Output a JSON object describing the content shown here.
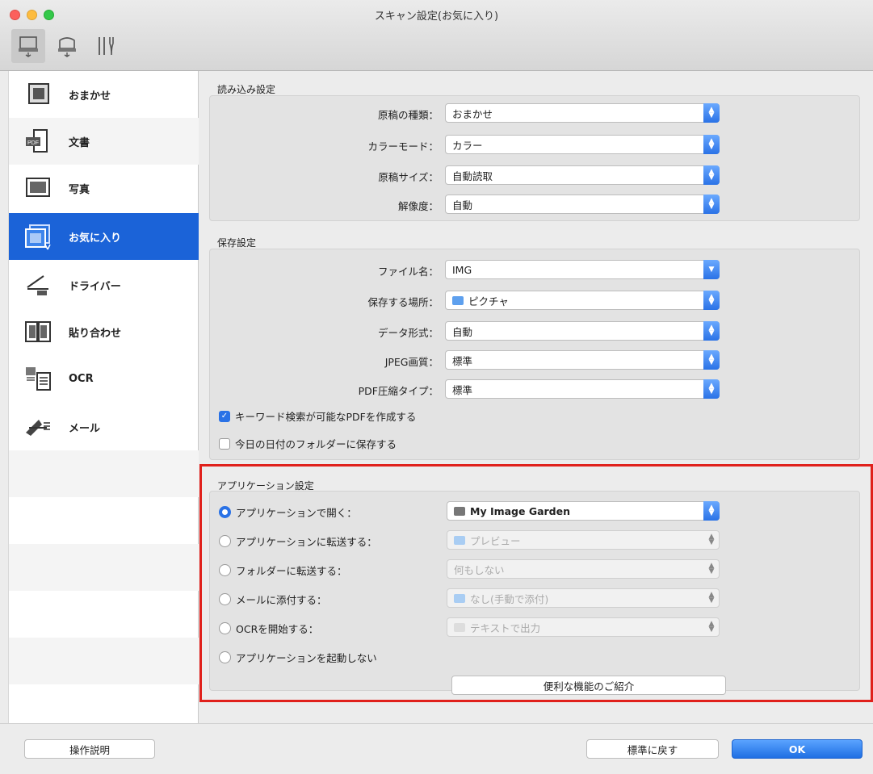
{
  "window": {
    "title": "スキャン設定(お気に入り)"
  },
  "toolbar": {
    "icons": [
      "scan-from-computer-icon",
      "scan-from-operation-panel-icon",
      "general-settings-icon"
    ]
  },
  "sidebar": {
    "items": [
      {
        "label": "おまかせ",
        "icon": "auto-scan-icon"
      },
      {
        "label": "文書",
        "icon": "document-pdf-icon"
      },
      {
        "label": "写真",
        "icon": "photo-icon"
      },
      {
        "label": "お気に入り",
        "icon": "favorites-icon"
      },
      {
        "label": "ドライバー",
        "icon": "driver-icon"
      },
      {
        "label": "貼り合わせ",
        "icon": "stitch-icon"
      },
      {
        "label": "OCR",
        "icon": "ocr-icon"
      },
      {
        "label": "メール",
        "icon": "email-icon"
      }
    ],
    "selected": "お気に入り"
  },
  "scan_settings": {
    "title": "読み込み設定",
    "fields": [
      {
        "label": "原稿の種類：",
        "value": "おまかせ"
      },
      {
        "label": "カラーモード：",
        "value": "カラー"
      },
      {
        "label": "原稿サイズ：",
        "value": "自動読取"
      },
      {
        "label": "解像度：",
        "value": "自動"
      }
    ]
  },
  "save_settings": {
    "title": "保存設定",
    "file_name_label": "ファイル名：",
    "file_name_value": "IMG",
    "save_in_label": "保存する場所：",
    "save_in_value": "ピクチャ",
    "data_format_label": "データ形式：",
    "data_format_value": "自動",
    "jpeg_label": "JPEG画質：",
    "jpeg_value": "標準",
    "pdf_label": "PDF圧縮タイプ：",
    "pdf_value": "標準",
    "checkbox_keyword": "キーワード検索が可能なPDFを作成する",
    "checkbox_keyword_checked": true,
    "checkbox_date": "今日の日付のフォルダーに保存する",
    "checkbox_date_checked": false
  },
  "app_settings": {
    "title": "アプリケーション設定",
    "options": [
      {
        "label": "アプリケーションで開く：",
        "value": "My Image Garden",
        "selected": true
      },
      {
        "label": "アプリケーションに転送する：",
        "value": "プレビュー",
        "selected": false
      },
      {
        "label": "フォルダーに転送する：",
        "value": "何もしない",
        "selected": false
      },
      {
        "label": "メールに添付する：",
        "value": "なし(手動で添付)",
        "selected": false
      },
      {
        "label": "OCRを開始する：",
        "value": "テキストで出力",
        "selected": false
      },
      {
        "label": "アプリケーションを起動しない",
        "value": "",
        "selected": false
      }
    ],
    "more_functions_button": "便利な機能のご紹介"
  },
  "footer": {
    "instructions_button": "操作説明",
    "defaults_button": "標準に戻す",
    "ok_button": "OK"
  },
  "colors": {
    "accent": "#1b63d8",
    "highlight": "#e0201b"
  }
}
